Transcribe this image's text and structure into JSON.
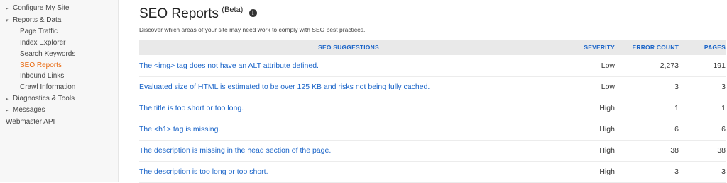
{
  "sidebar": {
    "items": [
      {
        "label": "Configure My Site",
        "caret": "▸"
      },
      {
        "label": "Reports & Data",
        "caret": "▾"
      },
      {
        "label": "Page Traffic"
      },
      {
        "label": "Index Explorer"
      },
      {
        "label": "Search Keywords"
      },
      {
        "label": "SEO Reports"
      },
      {
        "label": "Inbound Links"
      },
      {
        "label": "Crawl Information"
      },
      {
        "label": "Diagnostics & Tools",
        "caret": "▸"
      },
      {
        "label": "Messages",
        "caret": "▸"
      },
      {
        "label": "Webmaster API"
      }
    ],
    "active_color": "#e8660a"
  },
  "main": {
    "title": "SEO Reports",
    "beta": "(Beta)",
    "info_icon": "info-icon",
    "subtitle": "Discover which areas of your site may need work to comply with SEO best practices.",
    "table": {
      "headers": {
        "suggestions": "SEO SUGGESTIONS",
        "severity": "SEVERITY",
        "error_count": "ERROR COUNT",
        "pages": "PAGES"
      },
      "rows": [
        {
          "suggestion": "The <img> tag does not have an ALT attribute defined.",
          "severity": "Low",
          "errors": "2,273",
          "pages": "191"
        },
        {
          "suggestion": "Evaluated size of HTML is estimated to be over 125 KB and risks not being fully cached.",
          "severity": "Low",
          "errors": "3",
          "pages": "3"
        },
        {
          "suggestion": "The title is too short or too long.",
          "severity": "High",
          "errors": "1",
          "pages": "1"
        },
        {
          "suggestion": "The <h1> tag is missing.",
          "severity": "High",
          "errors": "6",
          "pages": "6"
        },
        {
          "suggestion": "The description is missing in the head section of the page.",
          "severity": "High",
          "errors": "38",
          "pages": "38"
        },
        {
          "suggestion": "The description is too long or too short.",
          "severity": "High",
          "errors": "3",
          "pages": "3"
        }
      ]
    }
  },
  "colors": {
    "link": "#1a64c8",
    "header_bg": "#e9e9e9",
    "sidebar_bg": "#f7f7f7"
  }
}
